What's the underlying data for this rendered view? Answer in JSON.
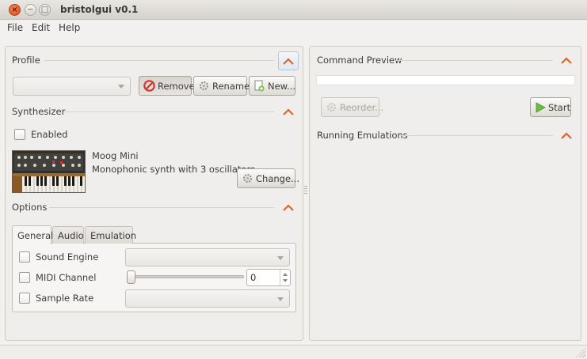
{
  "window": {
    "title": "bristolgui v0.1"
  },
  "menu": [
    "File",
    "Edit",
    "Help"
  ],
  "profile": {
    "title": "Profile",
    "combo_value": "",
    "buttons": {
      "remove": "Remove",
      "rename": "Rename",
      "new": "New..."
    }
  },
  "synthesizer": {
    "title": "Synthesizer",
    "enabled_label": "Enabled",
    "enabled": false,
    "name": "Moog Mini",
    "description": "Monophonic synth with 3 oscillators",
    "change_label": "Change..."
  },
  "options": {
    "title": "Options",
    "tabs": [
      "General",
      "Audio",
      "Emulation"
    ],
    "active_tab": "General",
    "rows": {
      "sound_engine": "Sound Engine",
      "midi_channel": "MIDI Channel",
      "sample_rate": "Sample Rate"
    },
    "midi_channel_value": "0"
  },
  "command_preview": {
    "title": "Command Preview",
    "text": "",
    "reorder_label": "Reorder...",
    "start_label": "Start"
  },
  "running": {
    "title": "Running Emulations"
  },
  "colors": {
    "close_button": "#dd4814",
    "chevron": "#e0652b",
    "remove_icon": "#d9342b",
    "start_icon": "#6cbf3c"
  }
}
